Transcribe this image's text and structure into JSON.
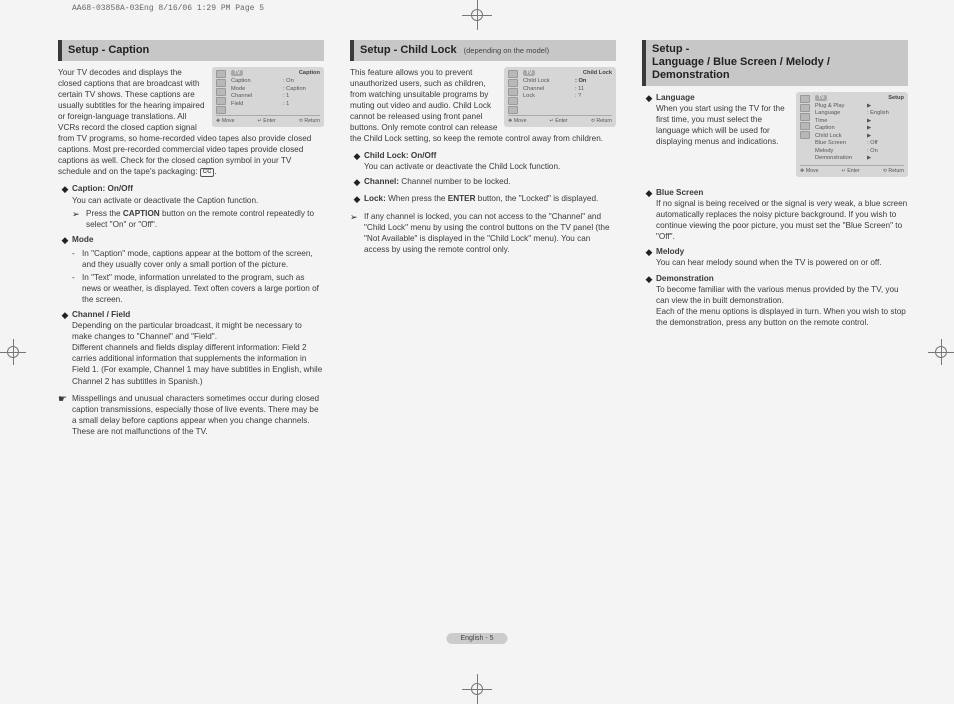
{
  "print_header": "AA68-03858A-03Eng  8/16/06  1:29 PM  Page 5",
  "page_footer": "English - 5",
  "col1": {
    "title": "Setup - Caption",
    "intro": "Your TV decodes and displays the closed captions that are broadcast with certain TV shows. These captions are usually subtitles for the hearing impaired or foreign-language translations. All VCRs record the closed caption signal from TV programs, so home-recorded video tapes also provide closed captions. Most pre-recorded commercial video tapes provide closed captions as well. Check for the closed caption symbol in your TV schedule and on the tape's packaging: ",
    "cc_badge": "CC",
    "intro_tail": ".",
    "osd": {
      "tv": "TV",
      "title": "Caption",
      "rows": [
        {
          "l": "Caption",
          "r": ": On"
        },
        {
          "l": "Mode",
          "r": ": Caption"
        },
        {
          "l": "Channel",
          "r": ": 1"
        },
        {
          "l": "Field",
          "r": ": 1"
        }
      ],
      "nav": {
        "move": "Move",
        "enter": "Enter",
        "return": "Return"
      },
      "glyph_move": "✥",
      "glyph_enter": "↵",
      "glyph_return": "⟲"
    },
    "items": [
      {
        "label": "Caption: On/Off",
        "body": "You can activate or deactivate the Caption function.",
        "arrow": "Press the ",
        "arrow_bold": "CAPTION",
        "arrow_tail": " button on the remote control repeatedly to select \"On\" or \"Off\"."
      },
      {
        "label": "Mode",
        "dash1": "In \"Caption\" mode, captions appear at the bottom of the screen, and they usually cover only a small portion of the picture.",
        "dash2": "In \"Text\" mode, information unrelated to the program, such as news or weather, is displayed. Text often covers a large portion of the screen."
      },
      {
        "label": "Channel / Field",
        "body": "Depending on the particular broadcast, it might be necessary to make changes to \"Channel\" and \"Field\".",
        "body2": "Different channels and fields display different information: Field 2 carries additional information that  supplements the information in Field 1.  (For example, Channel 1 may have subtitles in English, while Channel 2 has subtitles in Spanish.)"
      }
    ],
    "note": "Misspellings and unusual characters sometimes occur during closed caption transmissions, especially those of live events. There may be a small delay before captions appear when you change channels. These are not malfunctions of the TV."
  },
  "col2": {
    "title": "Setup - Child Lock",
    "title_sub": "(depending on the model)",
    "intro": "This feature allows you to prevent unauthorized users, such as children, from watching unsuitable programs by muting out video and audio. Child Lock cannot be released using front panel buttons. Only remote control can release the Child Lock setting, so keep the remote control away from children.",
    "osd": {
      "tv": "TV",
      "title": "Child Lock",
      "rows": [
        {
          "l": "Child Lock",
          "r": ": On"
        },
        {
          "l": "Channel",
          "r": ": 11"
        },
        {
          "l": "Lock",
          "r": ": ?"
        }
      ],
      "nav": {
        "move": "Move",
        "enter": "Enter",
        "return": "Return"
      },
      "glyph_move": "✥",
      "glyph_enter": "↵",
      "glyph_return": "⟲"
    },
    "items": [
      {
        "label": "Child Lock: On/Off",
        "body": "You can activate or deactivate the Child Lock function."
      },
      {
        "label_inline": "Channel:",
        "body": " Channel number to be locked."
      },
      {
        "label_inline": "Lock:",
        "body": " When press the ",
        "bold": "ENTER",
        "tail": " button, the \"Locked\" is displayed."
      }
    ],
    "arrow_note": "If any channel is locked, you can not access to the \"Channel\" and \"Child Lock\" menu by using the control buttons on the TV panel (the \"Not Available\" is displayed in the \"Child Lock\" menu). You can access by using the remote control only."
  },
  "col3": {
    "title_l1": "Setup -",
    "title_l2": "Language / Blue Screen / Melody / Demonstration",
    "osd": {
      "tv": "TV",
      "title": "Setup",
      "rows": [
        {
          "l": "Plug & Play",
          "r": "▶"
        },
        {
          "l": "Language",
          "r": ": English"
        },
        {
          "l": "Time",
          "r": "▶"
        },
        {
          "l": "Caption",
          "r": "▶"
        },
        {
          "l": "Child Lock",
          "r": "▶"
        },
        {
          "l": "Blue Screen",
          "r": ": Off"
        },
        {
          "l": "Melody",
          "r": ": On"
        },
        {
          "l": "Demonstration",
          "r": "▶"
        }
      ],
      "nav": {
        "move": "Move",
        "enter": "Enter",
        "return": "Return"
      },
      "glyph_move": "✥",
      "glyph_enter": "↵",
      "glyph_return": "⟲"
    },
    "items": [
      {
        "label": "Language",
        "body": "When you start using the TV for the first time, you must select the language which will be used for displaying menus and indications."
      },
      {
        "label": "Blue Screen",
        "body": "If no signal is being received or the signal is very weak, a blue screen automatically replaces the noisy picture background. If you wish to continue viewing the poor picture, you must set the \"Blue Screen\" to \"Off\"."
      },
      {
        "label": "Melody",
        "body": "You can hear melody sound when the TV is powered on or off."
      },
      {
        "label": "Demonstration",
        "body": "To become familiar with the various menus provided by the TV, you can view the in built demonstration.",
        "body2": "Each of the menu options is displayed in turn. When you wish to stop the demonstration, press any button on the remote control."
      }
    ]
  }
}
